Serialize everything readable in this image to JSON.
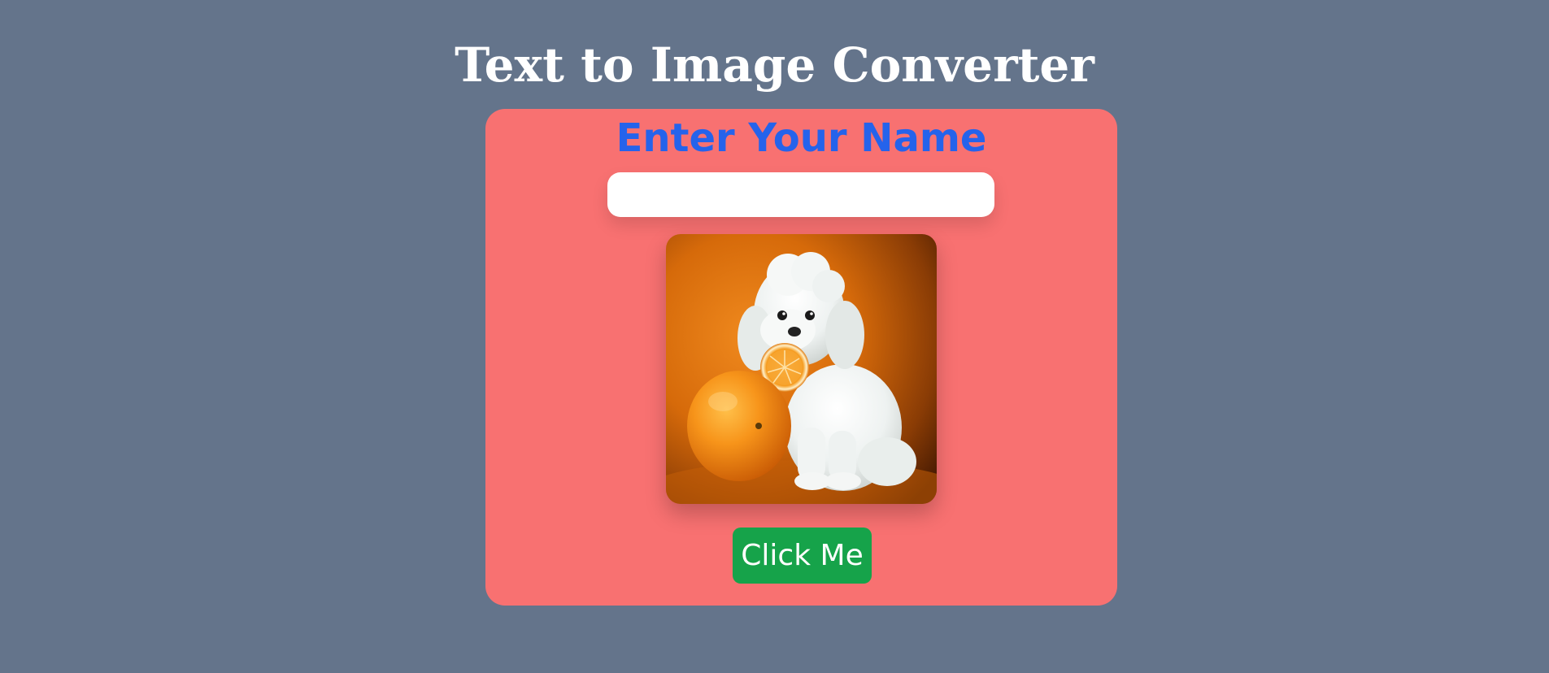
{
  "page": {
    "title": "Text to Image Converter"
  },
  "form": {
    "heading": "Enter Your Name",
    "name_input_value": "",
    "name_input_placeholder": "",
    "button_label": "Click Me"
  },
  "generated_image": {
    "subject": "white-dog-with-oranges-image"
  },
  "colors": {
    "background": "#64748b",
    "card": "#f87171",
    "heading": "#2563eb",
    "button": "#16a34a",
    "title": "#ffffff"
  }
}
